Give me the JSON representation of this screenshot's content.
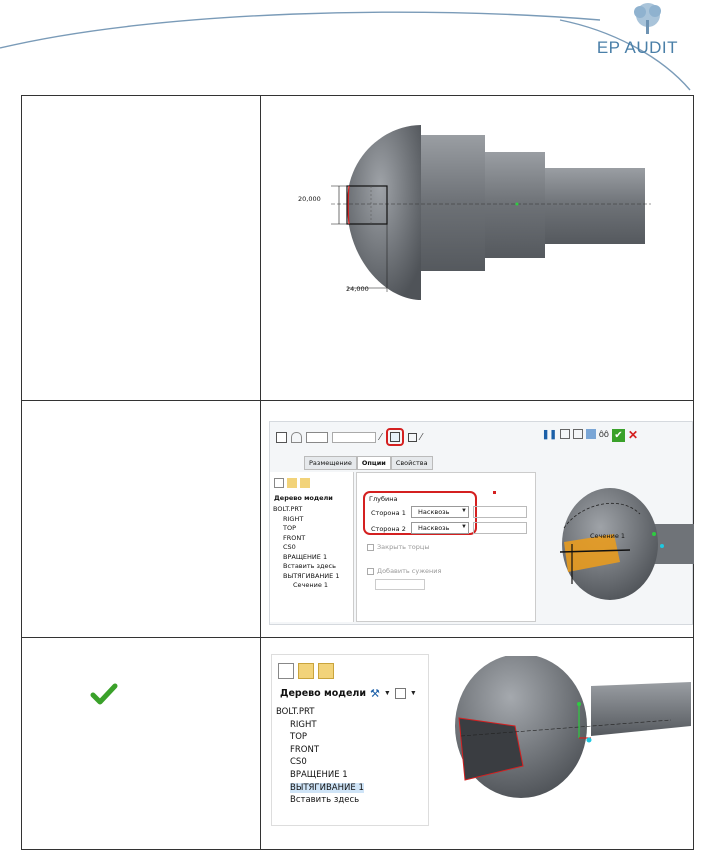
{
  "header": {
    "logo_text": "EP AUDIT"
  },
  "row1": {
    "dim_vertical": "20,000",
    "dim_horizontal": "24,000"
  },
  "row2": {
    "tabs": [
      "Размещение",
      "Опции",
      "Свойства"
    ],
    "tree_title": "Дерево модели",
    "tree_items": [
      "BOLT.PRT",
      "RIGHT",
      "TOP",
      "FRONT",
      "CS0",
      "ВРАЩЕНИЕ 1",
      "Вставить здесь",
      "ВЫТЯГИВАНИЕ 1",
      "Сечение 1"
    ],
    "depth_label": "Глубина",
    "side1_label": "Сторона 1",
    "side1_value": "Насквозь",
    "side2_label": "Сторона 2",
    "side2_value": "Насквозь",
    "close_ends": "Закрыть торцы",
    "add_taper": "Добавить сужения",
    "section_label": "Сечение 1"
  },
  "row3": {
    "tree_title": "Дерево модели",
    "tree_items": [
      "BOLT.PRT",
      "RIGHT",
      "TOP",
      "FRONT",
      "CS0",
      "ВРАЩЕНИЕ 1",
      "ВЫТЯГИВАНИЕ 1",
      "Вставить здесь"
    ]
  },
  "colors": {
    "accent_red": "#d42020",
    "check_green": "#3aa12a",
    "logo_blue": "#4a7fa8",
    "part_gray": "#6f7378"
  }
}
